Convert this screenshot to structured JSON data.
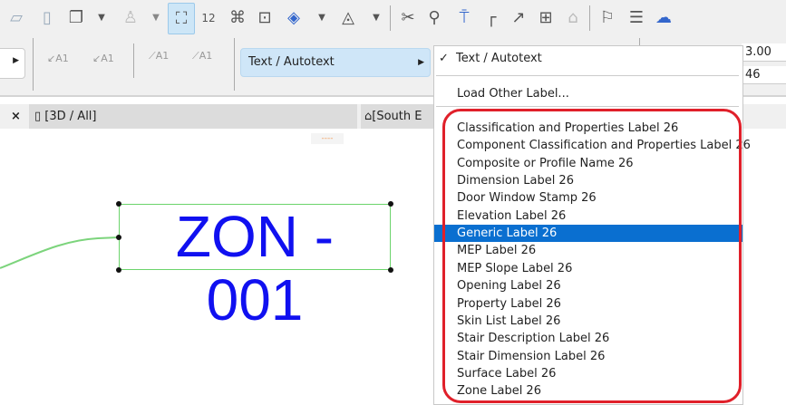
{
  "toolbar": {
    "icons": [
      "slab-icon",
      "wall-icon",
      "window-icon",
      "object-icon",
      "label-tool-icon",
      "dimension-icon",
      "zone-icon",
      "group-icon",
      "fill-icon",
      "shape-icon",
      "split-icon",
      "adjust-icon",
      "elevate-icon",
      "offset-icon",
      "curve-icon",
      "resize-icon",
      "roof-icon",
      "flag-icon",
      "flag-list-icon",
      "cloud-icon"
    ]
  },
  "info_box": {
    "label_type_button": "Text / Autotext",
    "field_1": "3.00",
    "field_2": "46"
  },
  "tabs": {
    "close": "×",
    "tab_3d": "[3D / All]",
    "tab_south": "[South E"
  },
  "canvas": {
    "label_text": "ZON - 001",
    "label_color": "#1010f0"
  },
  "menu": {
    "checked_item": "Text / Autotext",
    "load_other": "Load Other Label...",
    "items": [
      "Classification and Properties Label 26",
      "Component Classification and Properties Label 26",
      "Composite or Profile Name 26",
      "Dimension Label 26",
      "Door Window Stamp 26",
      "Elevation Label 26",
      "Generic Label 26",
      "MEP Label 26",
      "MEP Slope Label 26",
      "Opening Label 26",
      "Property Label 26",
      "Skin List Label 26",
      "Stair Description Label 26",
      "Stair Dimension Label 26",
      "Surface Label 26",
      "Zone Label 26"
    ],
    "highlighted_index": 6,
    "highlight_color": "#0a6fd0",
    "annotation_color": "#e0202a"
  }
}
